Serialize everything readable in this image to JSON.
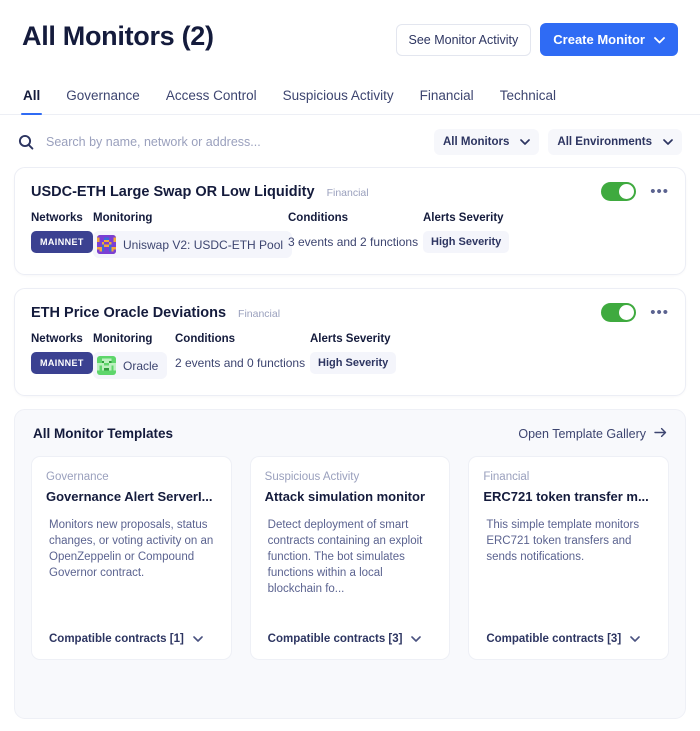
{
  "header": {
    "title": "All Monitors (2)",
    "see_activity_label": "See Monitor Activity",
    "create_label": "Create Monitor"
  },
  "tabs": [
    {
      "label": "All",
      "active": true
    },
    {
      "label": "Governance",
      "active": false
    },
    {
      "label": "Access Control",
      "active": false
    },
    {
      "label": "Suspicious Activity",
      "active": false
    },
    {
      "label": "Financial",
      "active": false
    },
    {
      "label": "Technical",
      "active": false
    }
  ],
  "search": {
    "placeholder": "Search by name, network or address...",
    "value": "",
    "icon": "search-icon"
  },
  "filters": [
    {
      "label": "All Monitors",
      "icon": "chevron-down-icon"
    },
    {
      "label": "All Environments",
      "icon": "chevron-down-icon"
    }
  ],
  "labels": {
    "networks": "Networks",
    "monitoring": "Monitoring",
    "conditions": "Conditions",
    "alerts_severity": "Alerts Severity"
  },
  "monitors": [
    {
      "name": "USDC-ETH Large Swap OR Low Liquidity",
      "category": "Financial",
      "enabled": true,
      "network": "MAINNET",
      "monitoring": "Uniswap V2: USDC-ETH Pool",
      "conditions": "3 events and 2 functions",
      "severity": "High Severity"
    },
    {
      "name": "ETH Price Oracle Deviations",
      "category": "Financial",
      "enabled": true,
      "network": "MAINNET",
      "monitoring": "Oracle",
      "conditions": "2 events and 0 functions",
      "severity": "High Severity"
    }
  ],
  "templates_panel": {
    "title": "All Monitor Templates",
    "gallery_link": "Open Template Gallery",
    "cards": [
      {
        "category": "Governance",
        "title": "Governance Alert ServerI...",
        "description": "Monitors new proposals, status changes, or voting activity on an OpenZeppelin or Compound Governor contract.",
        "footer": "Compatible contracts [1]"
      },
      {
        "category": "Suspicious Activity",
        "title": "Attack simulation monitor",
        "description": "Detect deployment of smart contracts containing an exploit function. The bot simulates functions within a local blockchain fo...",
        "footer": "Compatible contracts [3]"
      },
      {
        "category": "Financial",
        "title": "ERC721 token transfer m...",
        "description": "This simple template monitors ERC721 token transfers and sends notifications.",
        "footer": "Compatible contracts [3]"
      }
    ]
  },
  "colors": {
    "accent": "#2f6bf4",
    "toggle_on": "#3faa3f",
    "network_badge": "#3b4191",
    "title": "#141b3c",
    "panel_bg": "#f8f9fc"
  },
  "icons": {
    "chevron_down": "⌄",
    "arrow_right": "→",
    "kebab": "•••"
  }
}
